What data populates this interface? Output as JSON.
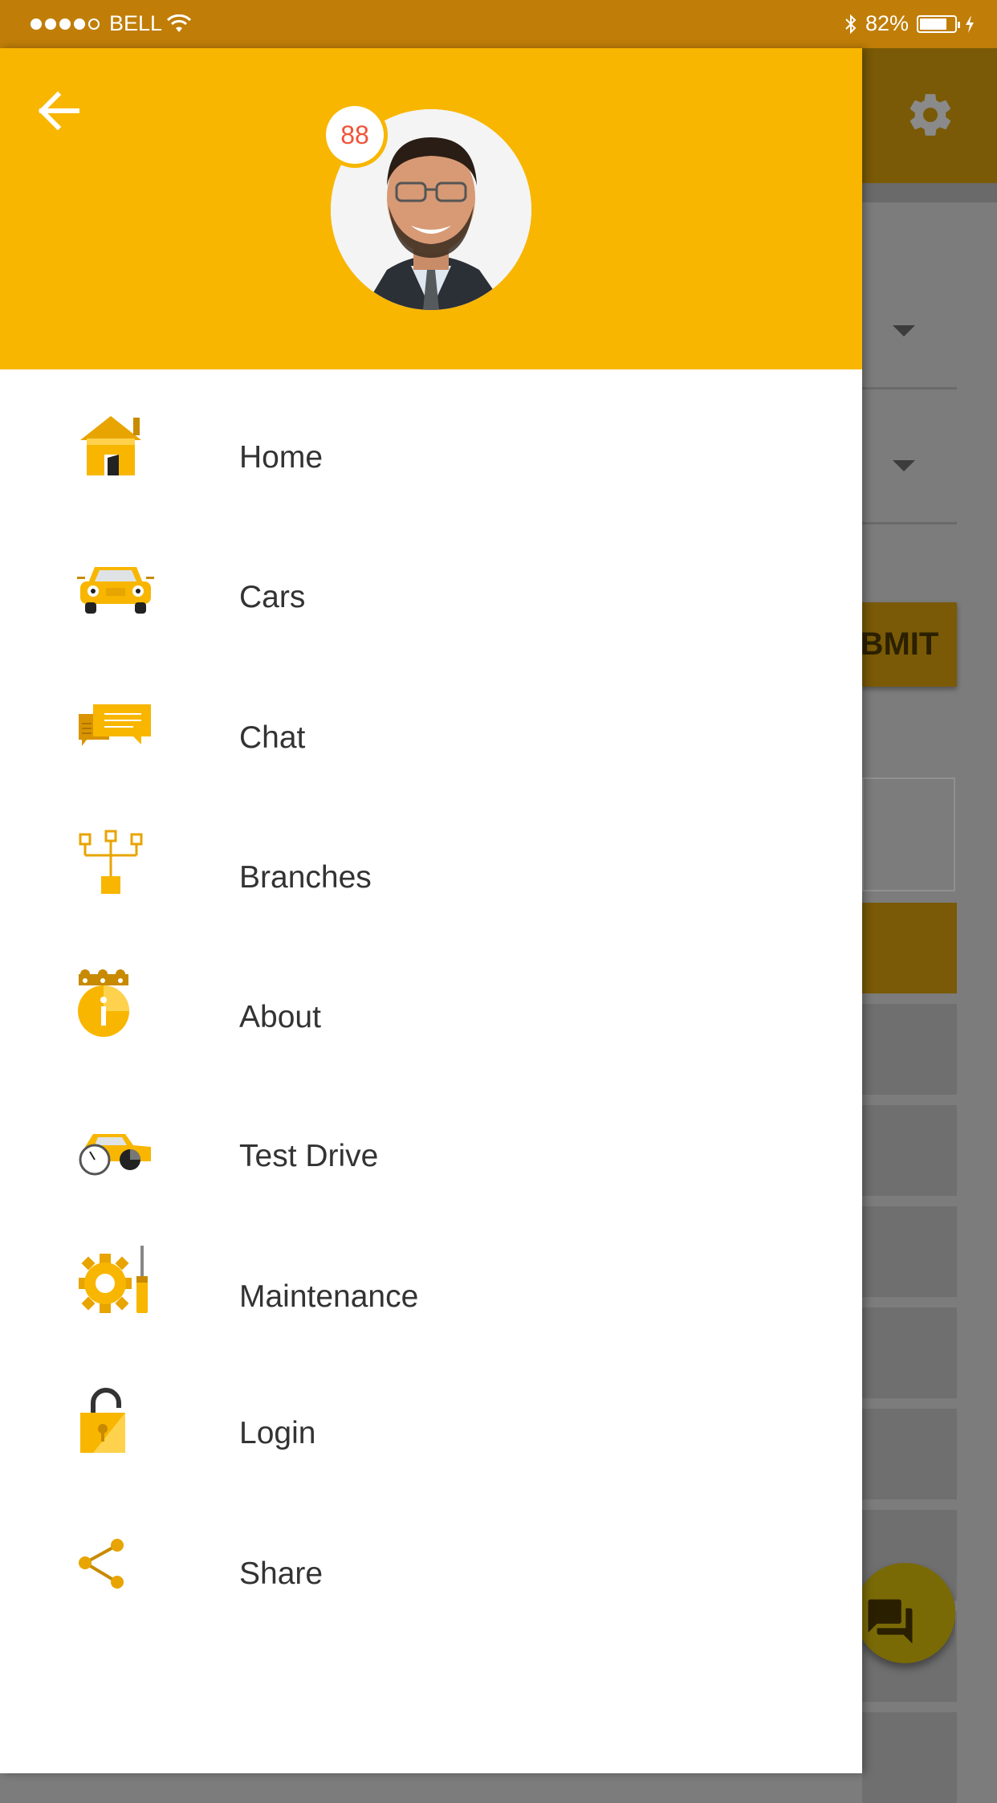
{
  "status_bar": {
    "carrier": "BELL",
    "battery_percent": "82%",
    "battery_level": 0.82
  },
  "drawer": {
    "badge_count": "88",
    "menu": [
      {
        "label": "Home",
        "icon": "home-icon"
      },
      {
        "label": "Cars",
        "icon": "car-icon"
      },
      {
        "label": "Chat",
        "icon": "chat-icon"
      },
      {
        "label": "Branches",
        "icon": "branches-icon"
      },
      {
        "label": "About",
        "icon": "about-icon"
      },
      {
        "label": "Test Drive",
        "icon": "test-drive-icon"
      },
      {
        "label": "Maintenance",
        "icon": "maintenance-icon"
      },
      {
        "label": "Login",
        "icon": "lock-icon"
      },
      {
        "label": "Share",
        "icon": "share-icon"
      }
    ]
  },
  "background_app": {
    "submit_label": "SUBMIT"
  },
  "colors": {
    "status_bar": "#c07e08",
    "accent": "#f8b600",
    "badge_text": "#f0533a",
    "label_text": "#333333"
  }
}
